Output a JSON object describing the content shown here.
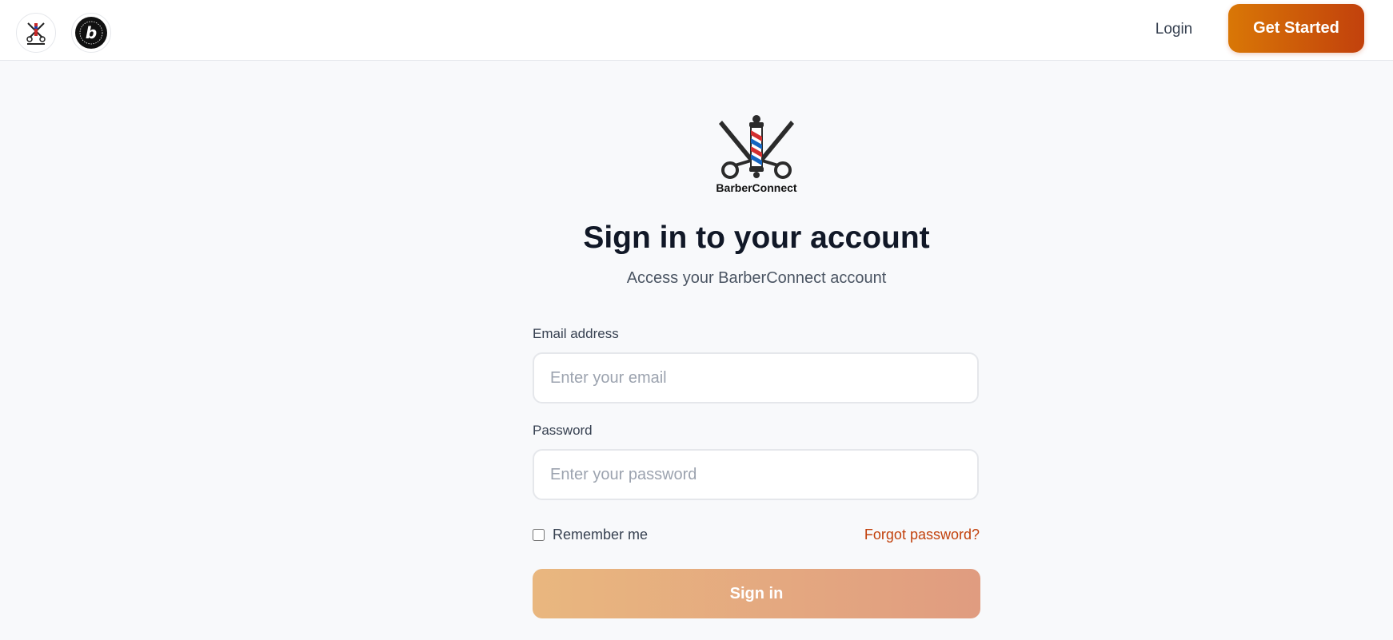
{
  "header": {
    "brand_logo_icon": "barberconnect-logo-icon",
    "badge_logo_icon": "b-badge-logo-icon",
    "login_label": "Login",
    "get_started_label": "Get Started",
    "accent_color": "#c2410c"
  },
  "main": {
    "logo_text": "BarberConnect",
    "title": "Sign in to your account",
    "subtitle": "Access your BarberConnect account",
    "email": {
      "label": "Email address",
      "value": "",
      "placeholder": "Enter your email"
    },
    "password": {
      "label": "Password",
      "value": "",
      "placeholder": "Enter your password"
    },
    "remember_me_label": "Remember me",
    "remember_me_checked": false,
    "forgot_password_label": "Forgot password?",
    "sign_in_label": "Sign in"
  }
}
